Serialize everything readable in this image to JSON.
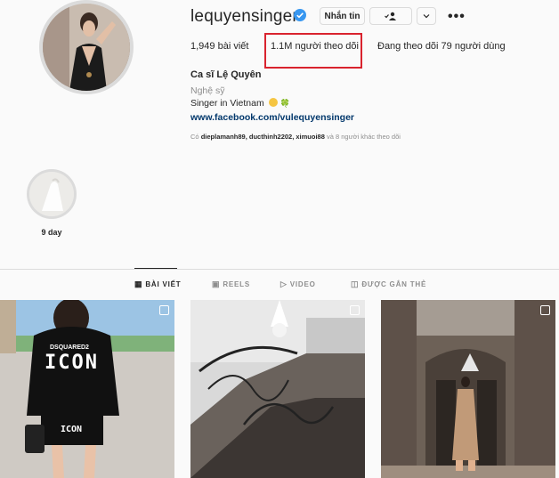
{
  "profile": {
    "username": "lequyensinger",
    "message_button": "Nhắn tin",
    "more": "•••",
    "stats": {
      "posts": "1,949 bài viết",
      "followers": "1.1M người theo dõi",
      "following": "Đang theo dõi 79 người dùng"
    },
    "bio": {
      "name": "Ca sĩ Lệ Quyên",
      "category": "Nghệ sỹ",
      "text": "Singer in Vietnam",
      "emojis": "🍀",
      "link": "www.facebook.com/vulequyensinger"
    },
    "followed_by": {
      "prefix": "Có",
      "users": "dieplamanh89, ducthinh2202, ximuoi88",
      "suffix": "và 8 người khác theo dõi"
    }
  },
  "highlight": {
    "label": "9 day"
  },
  "tabs": [
    {
      "label": "BÀI VIẾT",
      "icon": "grid-icon",
      "active": true
    },
    {
      "label": "REELS",
      "icon": "reels-icon",
      "active": false
    },
    {
      "label": "VIDEO",
      "icon": "video-icon",
      "active": false
    },
    {
      "label": "ĐƯỢC GẮN THẺ",
      "icon": "tagged-icon",
      "active": false
    }
  ],
  "posts": [
    {
      "text": "ICON",
      "brand": "DSQUARED2"
    },
    {
      "text": ""
    },
    {
      "text": ""
    }
  ],
  "colors": {
    "highlight_border": "#d9232e",
    "verified": "#3897f0",
    "link": "#00376b",
    "muted": "#8e8e8e"
  }
}
